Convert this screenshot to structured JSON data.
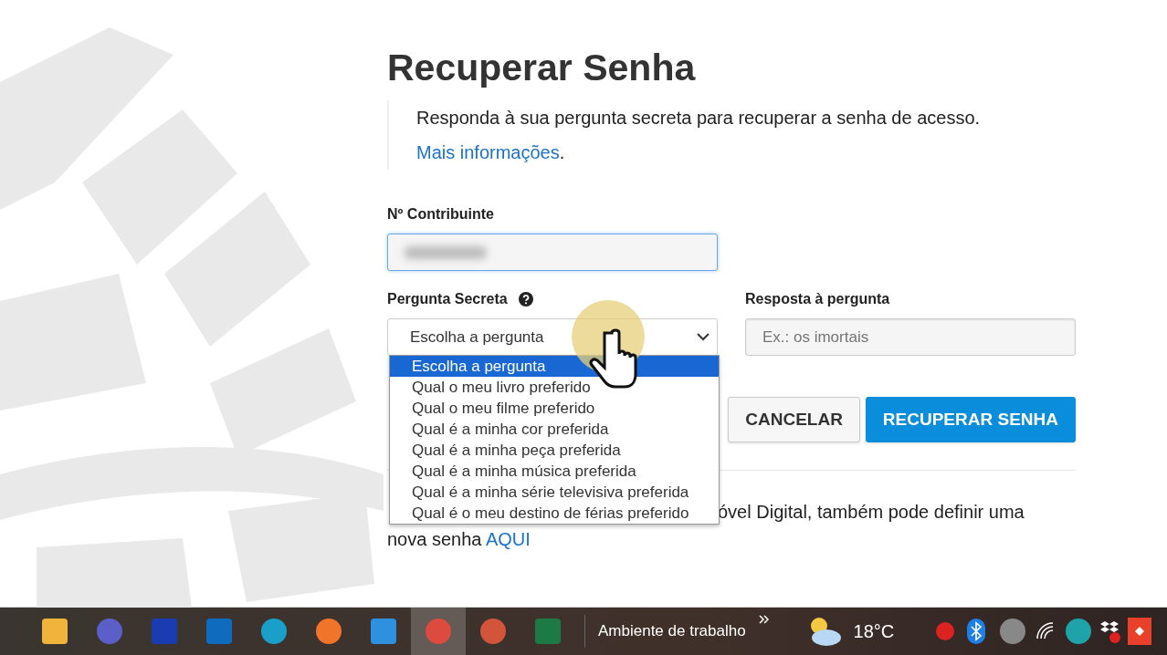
{
  "page": {
    "title": "Recuperar Senha",
    "intro": "Responda à sua pergunta secreta para recuperar a senha de acesso.",
    "more_link": "Mais informações",
    "more_link_suffix": "."
  },
  "form": {
    "taxpayer_label": "Nº Contribuinte",
    "question_label": "Pergunta Secreta",
    "question_value": "Escolha a pergunta",
    "question_expanded": true,
    "options": [
      {
        "label": "Escolha a pergunta",
        "selected": true
      },
      {
        "label": "Qual o meu livro preferido",
        "selected": false
      },
      {
        "label": "Qual o meu filme preferido",
        "selected": false
      },
      {
        "label": "Qual é a minha cor preferida",
        "selected": false
      },
      {
        "label": "Qual é a minha peça preferida",
        "selected": false
      },
      {
        "label": "Qual é a minha música preferida",
        "selected": false
      },
      {
        "label": "Qual é a minha série televisiva preferida",
        "selected": false
      },
      {
        "label": "Qual é o meu destino de férias preferido",
        "selected": false
      }
    ],
    "answer_label": "Resposta à pergunta",
    "answer_placeholder": "Ex.: os imortais",
    "buttons": [
      {
        "label": "CANCELAR",
        "kind": "secondary"
      },
      {
        "label": "RECUPERAR SENHA",
        "kind": "primary"
      }
    ]
  },
  "footer_note": {
    "line_1": "óvel Digital, também pode definir uma",
    "line_2": "nova senha",
    "link": "AQUI"
  },
  "taskbar": {
    "toolbar_label": "Ambiente de trabalho",
    "temperature": "18°C"
  }
}
